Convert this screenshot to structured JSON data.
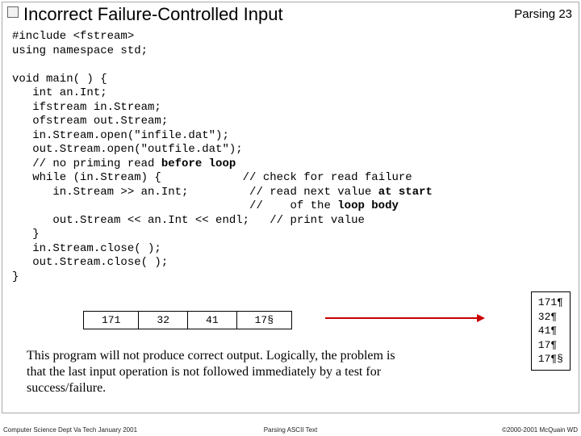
{
  "header": {
    "title": "Incorrect Failure-Controlled Input",
    "section": "Parsing",
    "page": "23"
  },
  "code": {
    "l1": "#include <fstream>",
    "l2": "using namespace std;",
    "l3": "",
    "l4": "void main( ) {",
    "l5": "   int an.Int;",
    "l6": "   ifstream in.Stream;",
    "l7": "   ofstream out.Stream;",
    "l8": "   in.Stream.open(\"infile.dat\");",
    "l9": "   out.Stream.open(\"outfile.dat\");",
    "l10a": "   // no priming read ",
    "l10b": "before loop",
    "l11a": "   while (in.Stream) {",
    "l11b": "            // check for read failure",
    "l12a": "      in.Stream >> an.Int;",
    "l12b": "         // read next value ",
    "l12c": "at start",
    "l13a": "",
    "l13b": "                                   //    of the ",
    "l13c": "loop body",
    "l14a": "      out.Stream << an.Int << endl;",
    "l14b": "   // print value",
    "l15": "   }",
    "l16": "   in.Stream.close( );",
    "l17": "   out.Stream.close( );",
    "l18": "}"
  },
  "input_row": {
    "c1": "171",
    "c2": "32",
    "c3": "41",
    "c4": "17§"
  },
  "output_box": {
    "o1": "171¶",
    "o2": "32¶",
    "o3": "41¶",
    "o4": "17¶",
    "o5": "17¶§"
  },
  "explanation": {
    "text": "This program will not produce correct output.  Logically, the problem is that the last input operation is not followed immediately by a test for success/failure."
  },
  "footer": {
    "left": "Computer Science Dept Va Tech January 2001",
    "center": "Parsing ASCII Text",
    "right": "©2000-2001  McQuain WD"
  }
}
